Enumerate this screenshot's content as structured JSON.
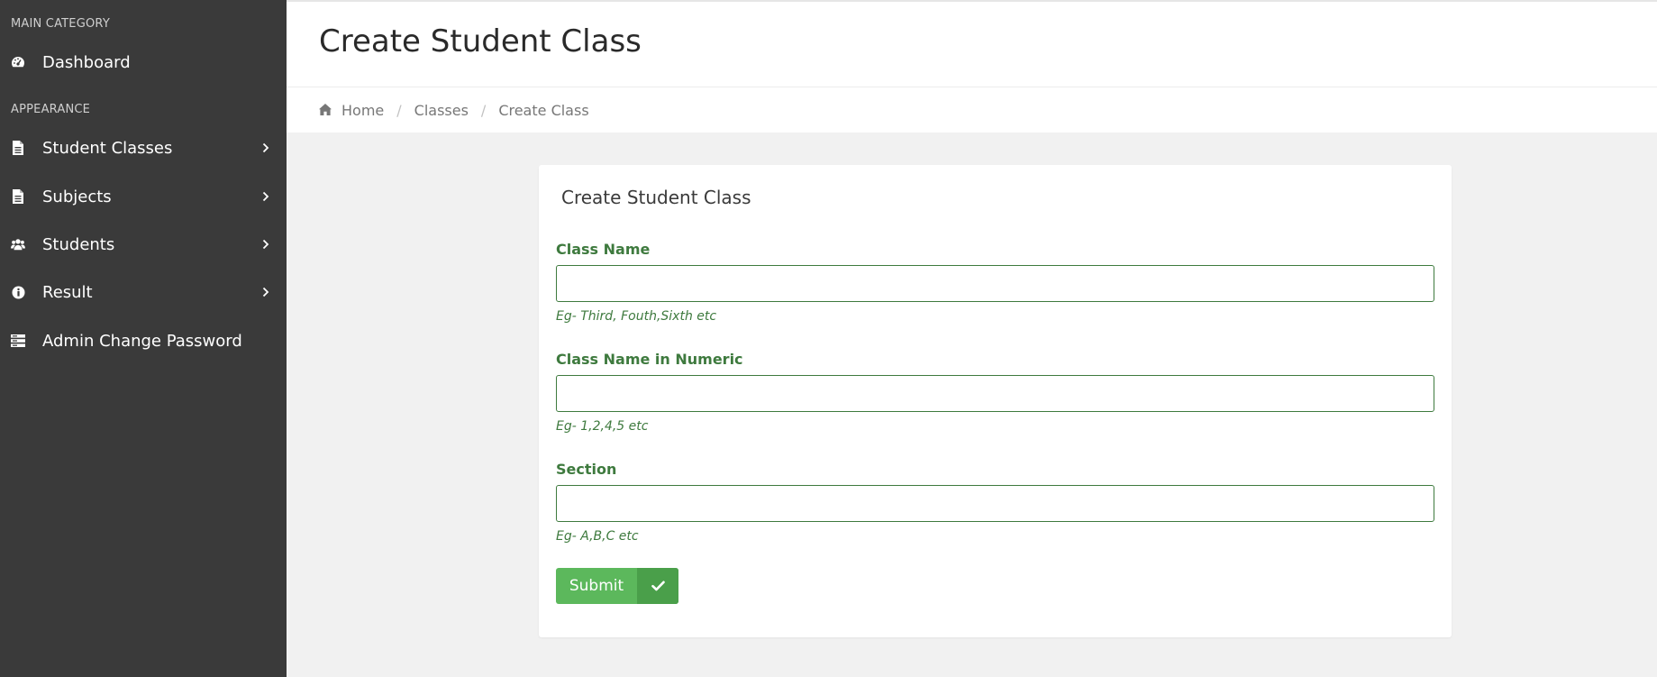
{
  "sidebar": {
    "categories": [
      "MAIN CATEGORY",
      "APPEARANCE"
    ],
    "items": [
      {
        "label": "Dashboard",
        "icon": "dashboard-icon"
      },
      {
        "label": "Student Classes",
        "icon": "file-icon"
      },
      {
        "label": "Subjects",
        "icon": "file-icon"
      },
      {
        "label": "Students",
        "icon": "users-icon"
      },
      {
        "label": "Result",
        "icon": "info-icon"
      },
      {
        "label": "Admin Change Password",
        "icon": "server-icon"
      }
    ]
  },
  "header": {
    "title": "Create Student Class"
  },
  "breadcrumb": {
    "home": "Home",
    "classes": "Classes",
    "current": "Create Class",
    "separator": "/"
  },
  "form": {
    "title": "Create Student Class",
    "fields": [
      {
        "label": "Class Name",
        "value": "",
        "help": "Eg- Third, Fouth,Sixth etc"
      },
      {
        "label": "Class Name in Numeric",
        "value": "",
        "help": "Eg- 1,2,4,5 etc"
      },
      {
        "label": "Section",
        "value": "",
        "help": "Eg- A,B,C etc"
      }
    ],
    "submit_label": "Submit"
  },
  "colors": {
    "sidebar_bg": "#3a3a3a",
    "accent_green": "#3e7a3e",
    "button_green": "#5cb85c",
    "button_green_dark": "#4a9f4a"
  }
}
